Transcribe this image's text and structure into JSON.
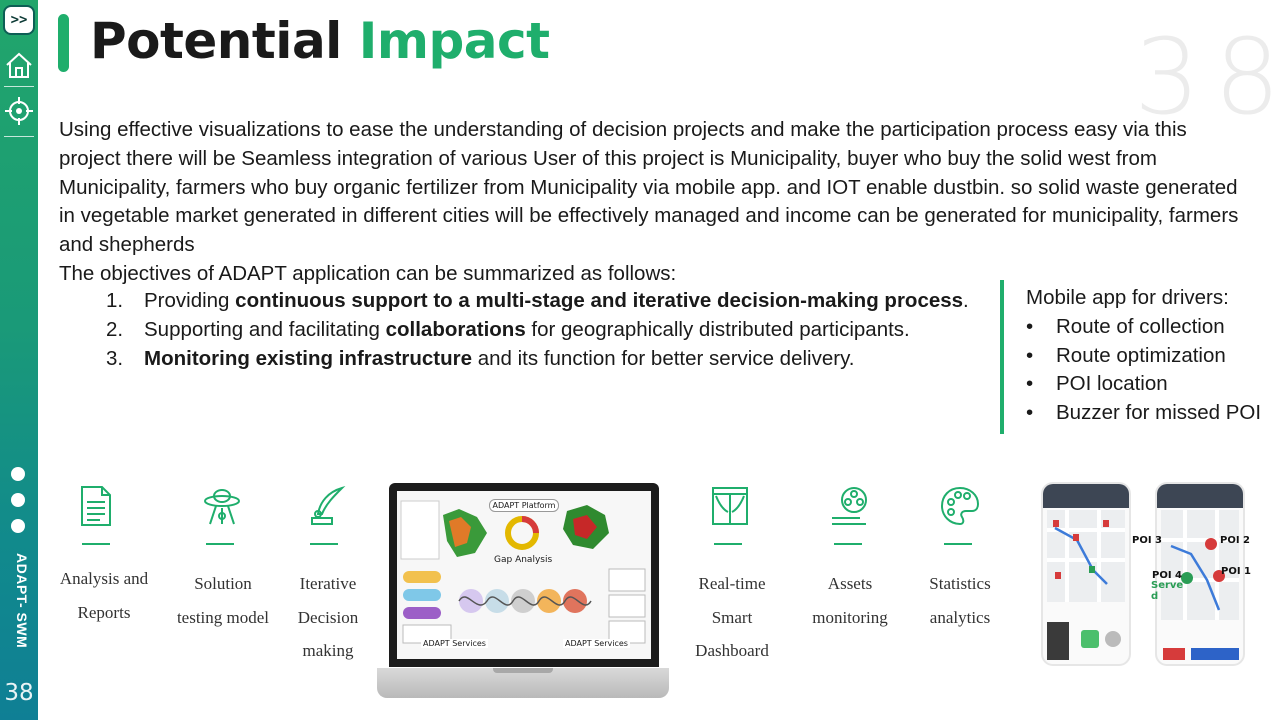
{
  "sidebar": {
    "expand_label": ">>",
    "icons": [
      "home-icon",
      "target-icon"
    ],
    "vertical_label": "ADAPT- SWM",
    "page_number": "38"
  },
  "header": {
    "title_part1": "Potential",
    "title_part2": "Impact",
    "slide_number": "38"
  },
  "body": {
    "paragraph": "Using effective visualizations to ease the understanding of decision projects and make the participation process easy via this project there will be Seamless integration of various User of this project is Municipality, buyer who buy the solid west from Municipality, farmers who buy organic fertilizer from Municipality via mobile app. and IOT enable dustbin. so solid waste generated in vegetable market generated in different cities will be effectively managed and income can be generated for municipality, farmers and shepherds",
    "objectives_intro": "The objectives of ADAPT application can be summarized as follows:",
    "objectives": [
      {
        "num": "1.",
        "pre": "Providing ",
        "bold": "continuous support to a multi-stage and iterative decision-making process",
        "post": "."
      },
      {
        "num": "2.",
        "pre": "Supporting and facilitating ",
        "bold": "collaborations",
        "post": " for geographically distributed participants."
      },
      {
        "num": "3.",
        "pre": "",
        "bold": "Monitoring existing infrastructure",
        "post": " and its function for better service delivery."
      }
    ]
  },
  "mobile_box": {
    "heading": "Mobile app for drivers:",
    "items": [
      "Route of collection",
      "Route optimization",
      "POI location",
      "Buzzer for missed POI"
    ]
  },
  "features": [
    {
      "icon": "document-icon",
      "lines": [
        "Analysis and",
        "Reports"
      ]
    },
    {
      "icon": "ufo-icon",
      "lines": [
        "Solution",
        "testing model"
      ]
    },
    {
      "icon": "quill-icon",
      "lines": [
        "Iterative",
        "Decision",
        "making"
      ]
    },
    {
      "icon": "window-icon",
      "lines": [
        "Real-time",
        "Smart",
        "Dashboard"
      ]
    },
    {
      "icon": "film-reel-icon",
      "lines": [
        "Assets",
        "monitoring"
      ]
    },
    {
      "icon": "palette-icon",
      "lines": [
        "Statistics",
        "analytics"
      ]
    }
  ],
  "laptop": {
    "platform_title": "ADAPT Platform",
    "gap_label": "Gap Analysis",
    "services_left": "ADAPT Services",
    "services_right": "ADAPT Services"
  },
  "phones": {
    "poi_labels": [
      "POI 3",
      "POI 2",
      "POI 4",
      "POI 1"
    ],
    "served_label": "Serve d"
  },
  "colors": {
    "accent": "#1fae6c",
    "sidebar_top": "#21a56b",
    "sidebar_bottom": "#0f7f95"
  }
}
